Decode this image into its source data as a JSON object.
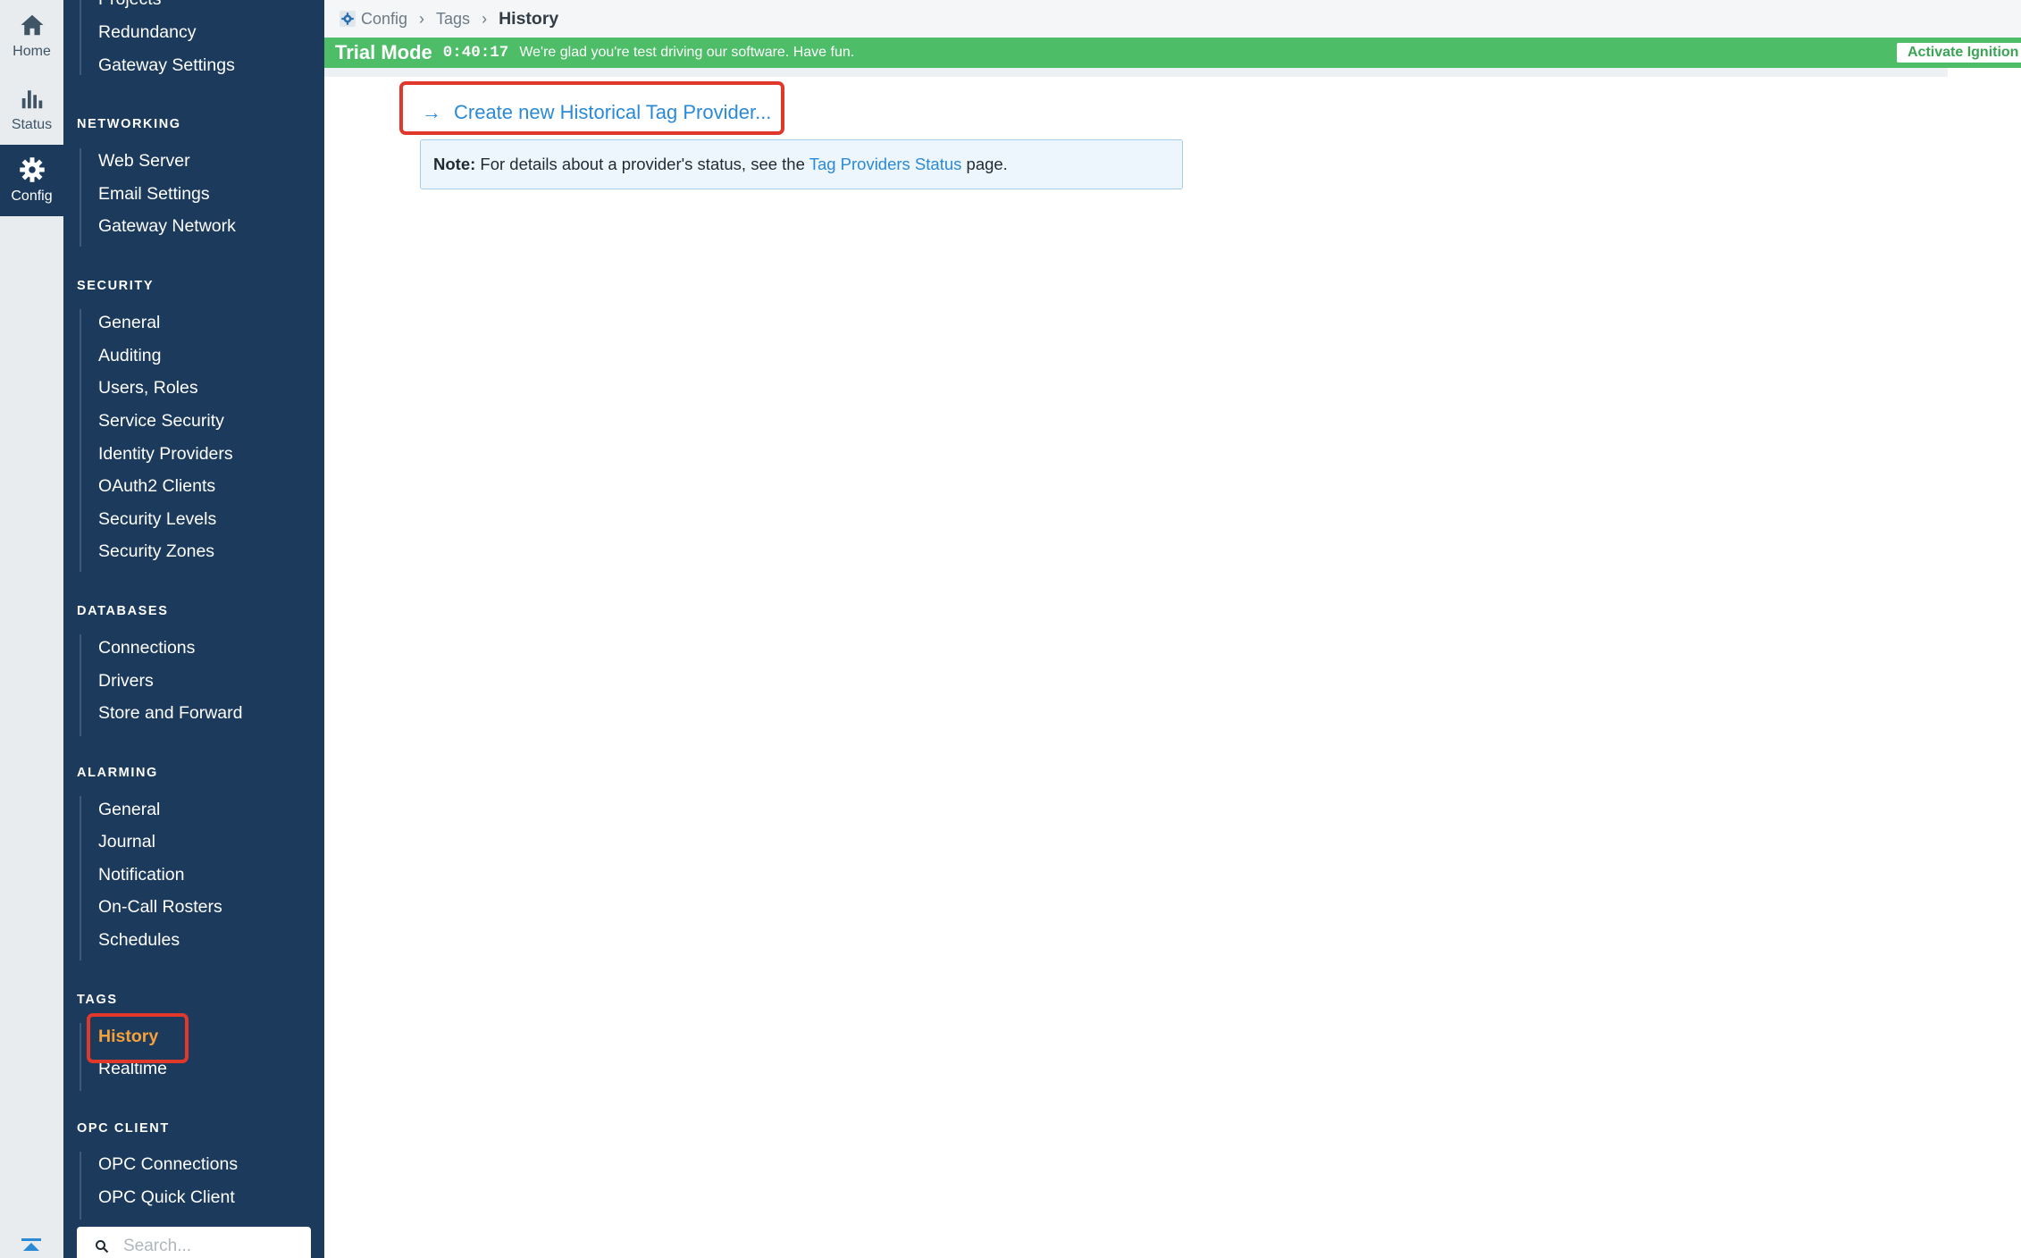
{
  "rail": {
    "items": [
      {
        "label": "Home",
        "icon": "home-icon"
      },
      {
        "label": "Status",
        "icon": "bar-chart-icon"
      },
      {
        "label": "Config",
        "icon": "gear-icon"
      }
    ],
    "active": "Config"
  },
  "nav": {
    "top_items": [
      "Projects",
      "Redundancy",
      "Gateway Settings"
    ],
    "sections": [
      {
        "heading": "NETWORKING",
        "items": [
          "Web Server",
          "Email Settings",
          "Gateway Network"
        ]
      },
      {
        "heading": "SECURITY",
        "items": [
          "General",
          "Auditing",
          "Users, Roles",
          "Service Security",
          "Identity Providers",
          "OAuth2 Clients",
          "Security Levels",
          "Security Zones"
        ]
      },
      {
        "heading": "DATABASES",
        "items": [
          "Connections",
          "Drivers",
          "Store and Forward"
        ]
      },
      {
        "heading": "ALARMING",
        "items": [
          "General",
          "Journal",
          "Notification",
          "On-Call Rosters",
          "Schedules"
        ]
      },
      {
        "heading": "TAGS",
        "items": [
          "History",
          "Realtime"
        ]
      },
      {
        "heading": "OPC CLIENT",
        "items": [
          "OPC Connections",
          "OPC Quick Client"
        ]
      }
    ],
    "active_item": "History",
    "search_placeholder": "Search..."
  },
  "breadcrumb": {
    "items": [
      "Config",
      "Tags"
    ],
    "current": "History"
  },
  "trial": {
    "title": "Trial Mode",
    "timer": "0:40:17",
    "message": "We're glad you're test driving our software. Have fun.",
    "activate_label": "Activate Ignition"
  },
  "content": {
    "create_link": "Create new Historical Tag Provider...",
    "note_label": "Note:",
    "note_text": "For details about a provider's status, see the",
    "note_link": "Tag Providers Status",
    "note_suffix": "page."
  },
  "colors": {
    "nav_bg": "#1b3a5c",
    "trial_green": "#4dbd67",
    "link_blue": "#2a8ad6",
    "active_orange": "#f6a13a",
    "highlight_red": "#e0392b"
  }
}
